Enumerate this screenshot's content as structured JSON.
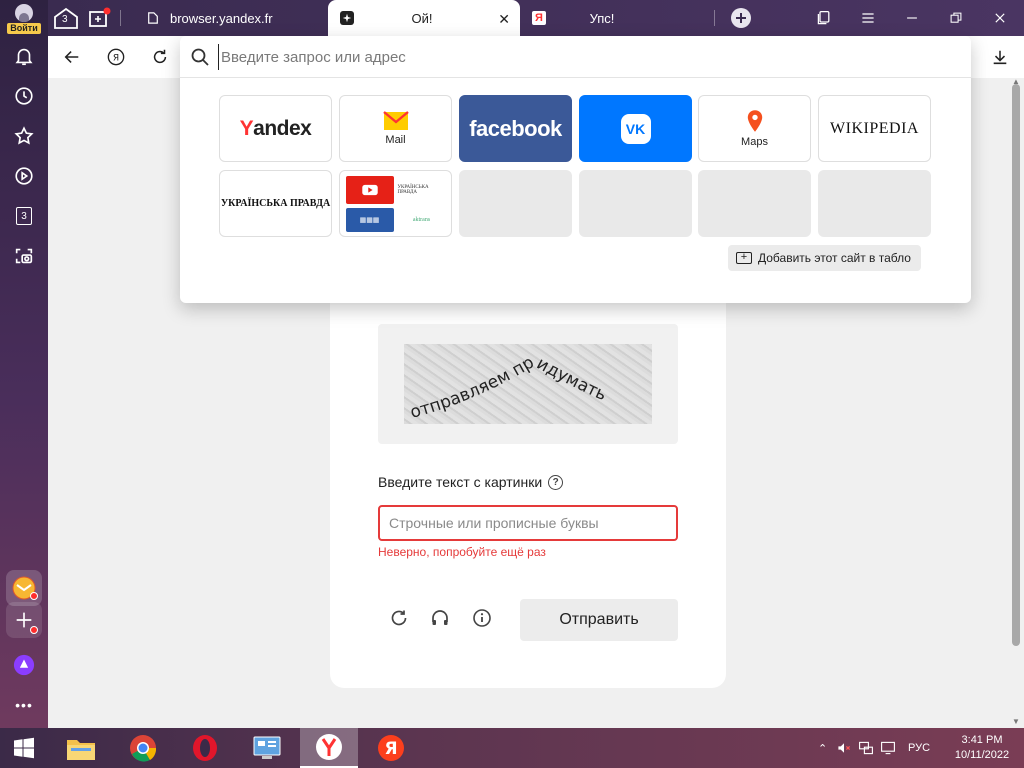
{
  "sidebar": {
    "login_label": "Войти",
    "tab_count": "3",
    "icons": [
      "bell-icon",
      "history-icon",
      "star-icon",
      "play-icon",
      "tabs-counter-icon",
      "screenshot-icon",
      "more-icon"
    ]
  },
  "tabstrip": {
    "group_count": "3",
    "tabs": [
      {
        "label": "browser.yandex.fr",
        "favicon": "page-icon",
        "active": false
      },
      {
        "label": "Ой!",
        "favicon": "spark-icon",
        "active": true
      },
      {
        "label": "Упс!",
        "favicon": "yandex-y-icon",
        "active": false
      }
    ]
  },
  "omnibox": {
    "placeholder": "Введите запрос или адрес",
    "tiles": [
      {
        "title": "Yandex"
      },
      {
        "title": "Mail"
      },
      {
        "title": "facebook"
      },
      {
        "title": "VK"
      },
      {
        "title": "Maps"
      },
      {
        "title": "Wikipedia",
        "display": "WIKIPEDIA"
      },
      {
        "title": "УКРАЇНСЬКА ПРАВДА"
      },
      {
        "title": "folder",
        "items": [
          "YouTube",
          "УКРАЇНСЬКА ПРАВДА",
          "site",
          "aktrans"
        ]
      }
    ],
    "add_site_label": "Добавить этот сайт в табло"
  },
  "captcha": {
    "image_text": "отправляем придумать",
    "field_label": "Введите текст с картинки",
    "input_placeholder": "Строчные или прописные буквы",
    "input_value": "",
    "error": "Неверно, попробуйте ещё раз",
    "submit_label": "Отправить"
  },
  "taskbar": {
    "apps": [
      "windows-start",
      "file-explorer",
      "chrome",
      "opera",
      "control-panel",
      "yandex-browser",
      "yandex"
    ],
    "language": "РУС",
    "time": "3:41 PM",
    "date": "10/11/2022"
  },
  "colors": {
    "error_red": "#e53a3a",
    "facebook_blue": "#3b5998",
    "vk_blue": "#0077ff",
    "yandex_red": "#ff3333"
  }
}
